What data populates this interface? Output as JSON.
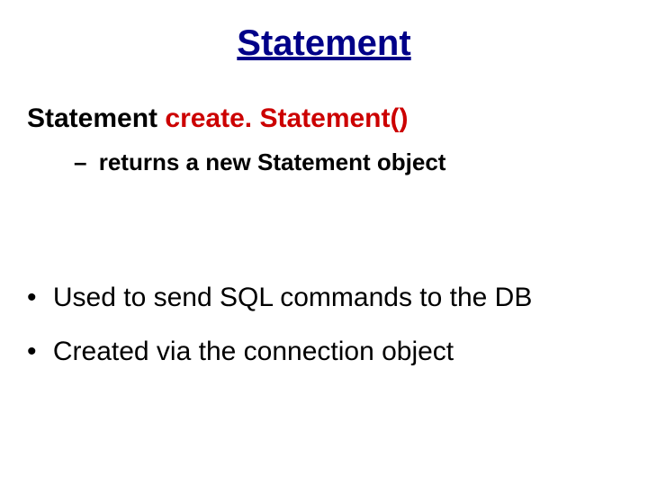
{
  "title": "Statement",
  "signature": {
    "type": "Statement",
    "method": "create. Statement()"
  },
  "sub": {
    "dash": "–",
    "text": "returns a new Statement object"
  },
  "bullets": [
    {
      "dot": "•",
      "text": "Used to send SQL commands to the DB"
    },
    {
      "dot": "•",
      "text": "Created via the connection object"
    }
  ]
}
